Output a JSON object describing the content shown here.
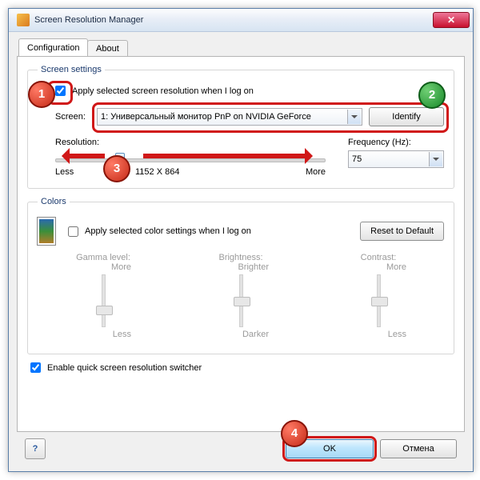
{
  "title": "Screen Resolution Manager",
  "tabs": {
    "configuration": "Configuration",
    "about": "About"
  },
  "screen": {
    "legend": "Screen settings",
    "apply_cb": "Apply selected screen resolution when I log on",
    "apply_checked": true,
    "screen_label": "Screen:",
    "screen_value": "1: Универсальный монитор PnP on NVIDIA GeForce",
    "identify": "Identify",
    "resolution_label": "Resolution:",
    "less": "Less",
    "more": "More",
    "res_value": "1152 X 864",
    "freq_label": "Frequency (Hz):",
    "freq_value": "75"
  },
  "colors": {
    "legend": "Colors",
    "apply_cb": "Apply selected color settings when I log on",
    "apply_checked": false,
    "reset": "Reset to Default",
    "gamma": "Gamma level:",
    "brightness": "Brightness:",
    "contrast": "Contrast:",
    "more": "More",
    "less": "Less",
    "brighter": "Brighter",
    "darker": "Darker"
  },
  "switcher": {
    "label": "Enable quick screen resolution switcher",
    "checked": true
  },
  "buttons": {
    "ok": "OK",
    "cancel": "Отмена",
    "help": "?"
  },
  "annot": {
    "1": "1",
    "2": "2",
    "3": "3",
    "4": "4"
  }
}
